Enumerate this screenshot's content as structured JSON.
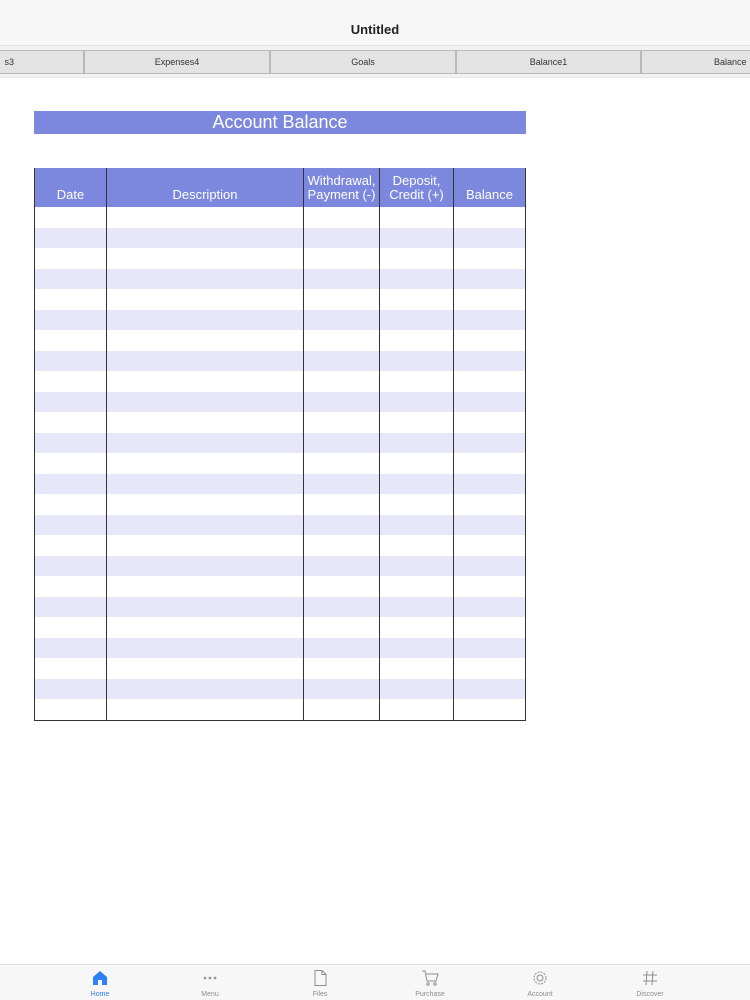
{
  "window": {
    "title": "Untitled"
  },
  "tabs": [
    {
      "label": "s3"
    },
    {
      "label": "Expenses4"
    },
    {
      "label": "Goals"
    },
    {
      "label": "Balance1"
    },
    {
      "label": "Balance"
    }
  ],
  "sheet": {
    "title": "Account Balance",
    "columns": [
      {
        "label": "Date"
      },
      {
        "label": "Description"
      },
      {
        "label": "Withdrawal, Payment (-)"
      },
      {
        "label": "Deposit, Credit (+)"
      },
      {
        "label": "Balance"
      }
    ],
    "row_count": 25
  },
  "bottom_nav": [
    {
      "label": "Home",
      "icon": "home-icon",
      "active": true
    },
    {
      "label": "Menu",
      "icon": "more-icon",
      "active": false
    },
    {
      "label": "Files",
      "icon": "file-icon",
      "active": false
    },
    {
      "label": "Purchase",
      "icon": "cart-icon",
      "active": false
    },
    {
      "label": "Account",
      "icon": "gear-icon",
      "active": false
    },
    {
      "label": "Discover",
      "icon": "hashtag-icon",
      "active": false
    }
  ],
  "colors": {
    "accent": "#7b88de",
    "stripe": "#e6e8fa",
    "active_nav": "#2f7ff6",
    "inactive_nav": "#8e8e8e"
  }
}
